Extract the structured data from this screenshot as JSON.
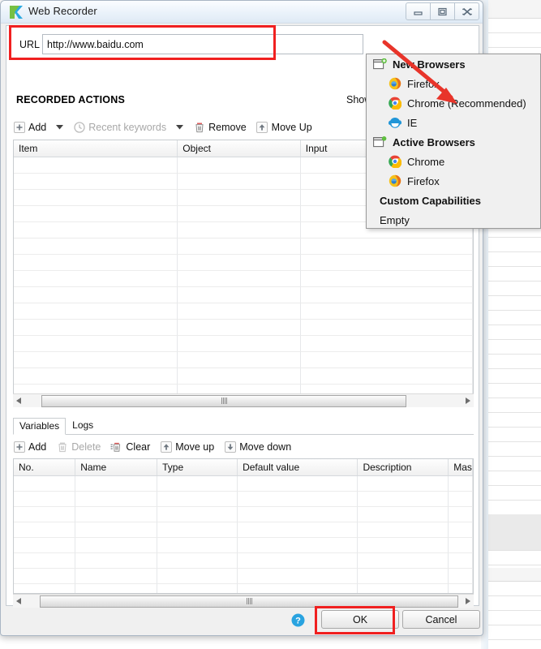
{
  "window": {
    "title": "Web Recorder",
    "logo_icon": "katalon-k-logo",
    "controls": [
      {
        "name": "minimize-button",
        "icon": "minimize-icon"
      },
      {
        "name": "maximize-button",
        "icon": "maximize-icon"
      },
      {
        "name": "close-button",
        "icon": "close-icon"
      }
    ]
  },
  "url_bar": {
    "label": "URL",
    "value": "http://www.baidu.com",
    "placeholder": "",
    "browser_icon": "chrome-icon",
    "dropdown_icon": "chevron-down-icon",
    "pause_icon": "pause-icon",
    "stop_icon": "stop-icon",
    "highlight_color": "#f02020"
  },
  "recorded_actions": {
    "heading": "RECORDED ACTIONS",
    "show_label": "Show",
    "toolbar": [
      {
        "label": "Add",
        "icon": "add-icon",
        "enabled": true,
        "has_dropdown": true
      },
      {
        "label": "Recent keywords",
        "icon": "clock-icon",
        "enabled": false,
        "has_dropdown": true
      },
      {
        "label": "Remove",
        "icon": "trash-icon",
        "enabled": true,
        "has_dropdown": false
      },
      {
        "label": "Move Up",
        "icon": "arrow-up-icon",
        "enabled": true,
        "has_dropdown": false
      }
    ],
    "columns": [
      "Item",
      "Object",
      "Input"
    ],
    "rows": []
  },
  "bottom_panel": {
    "tabs": [
      {
        "label": "Variables",
        "active": true
      },
      {
        "label": "Logs",
        "active": false
      }
    ],
    "toolbar": [
      {
        "label": "Add",
        "icon": "add-icon",
        "enabled": true
      },
      {
        "label": "Delete",
        "icon": "trash-icon",
        "enabled": false
      },
      {
        "label": "Clear",
        "icon": "clear-icon",
        "enabled": true
      },
      {
        "label": "Move up",
        "icon": "arrow-up-icon",
        "enabled": true
      },
      {
        "label": "Move down",
        "icon": "arrow-down-icon",
        "enabled": true
      }
    ],
    "columns": [
      "No.",
      "Name",
      "Type",
      "Default value",
      "Description",
      "Mas"
    ],
    "rows": []
  },
  "dialog_buttons": {
    "help_icon": "help-icon",
    "ok_label": "OK",
    "cancel_label": "Cancel",
    "ok_highlight_color": "#f02020"
  },
  "browser_menu": {
    "items": [
      {
        "label": "New Browsers",
        "icon": "new-browser-icon",
        "type": "group"
      },
      {
        "label": "Firefox",
        "icon": "firefox-icon",
        "type": "child"
      },
      {
        "label": "Chrome (Recommended)",
        "icon": "chrome-icon",
        "type": "child"
      },
      {
        "label": "IE",
        "icon": "ie-icon",
        "type": "child"
      },
      {
        "label": "Active Browsers",
        "icon": "active-browser-icon",
        "type": "group"
      },
      {
        "label": "Chrome",
        "icon": "chrome-icon",
        "type": "child"
      },
      {
        "label": "Firefox",
        "icon": "firefox-icon",
        "type": "child"
      },
      {
        "label": "Custom Capabilities",
        "icon": "",
        "type": "group-plain"
      },
      {
        "label": "Empty",
        "icon": "",
        "type": "plain"
      }
    ]
  },
  "annotation": {
    "arrow_color": "#e8342a",
    "arrow_target": "chrome-recommended-menu-item"
  }
}
